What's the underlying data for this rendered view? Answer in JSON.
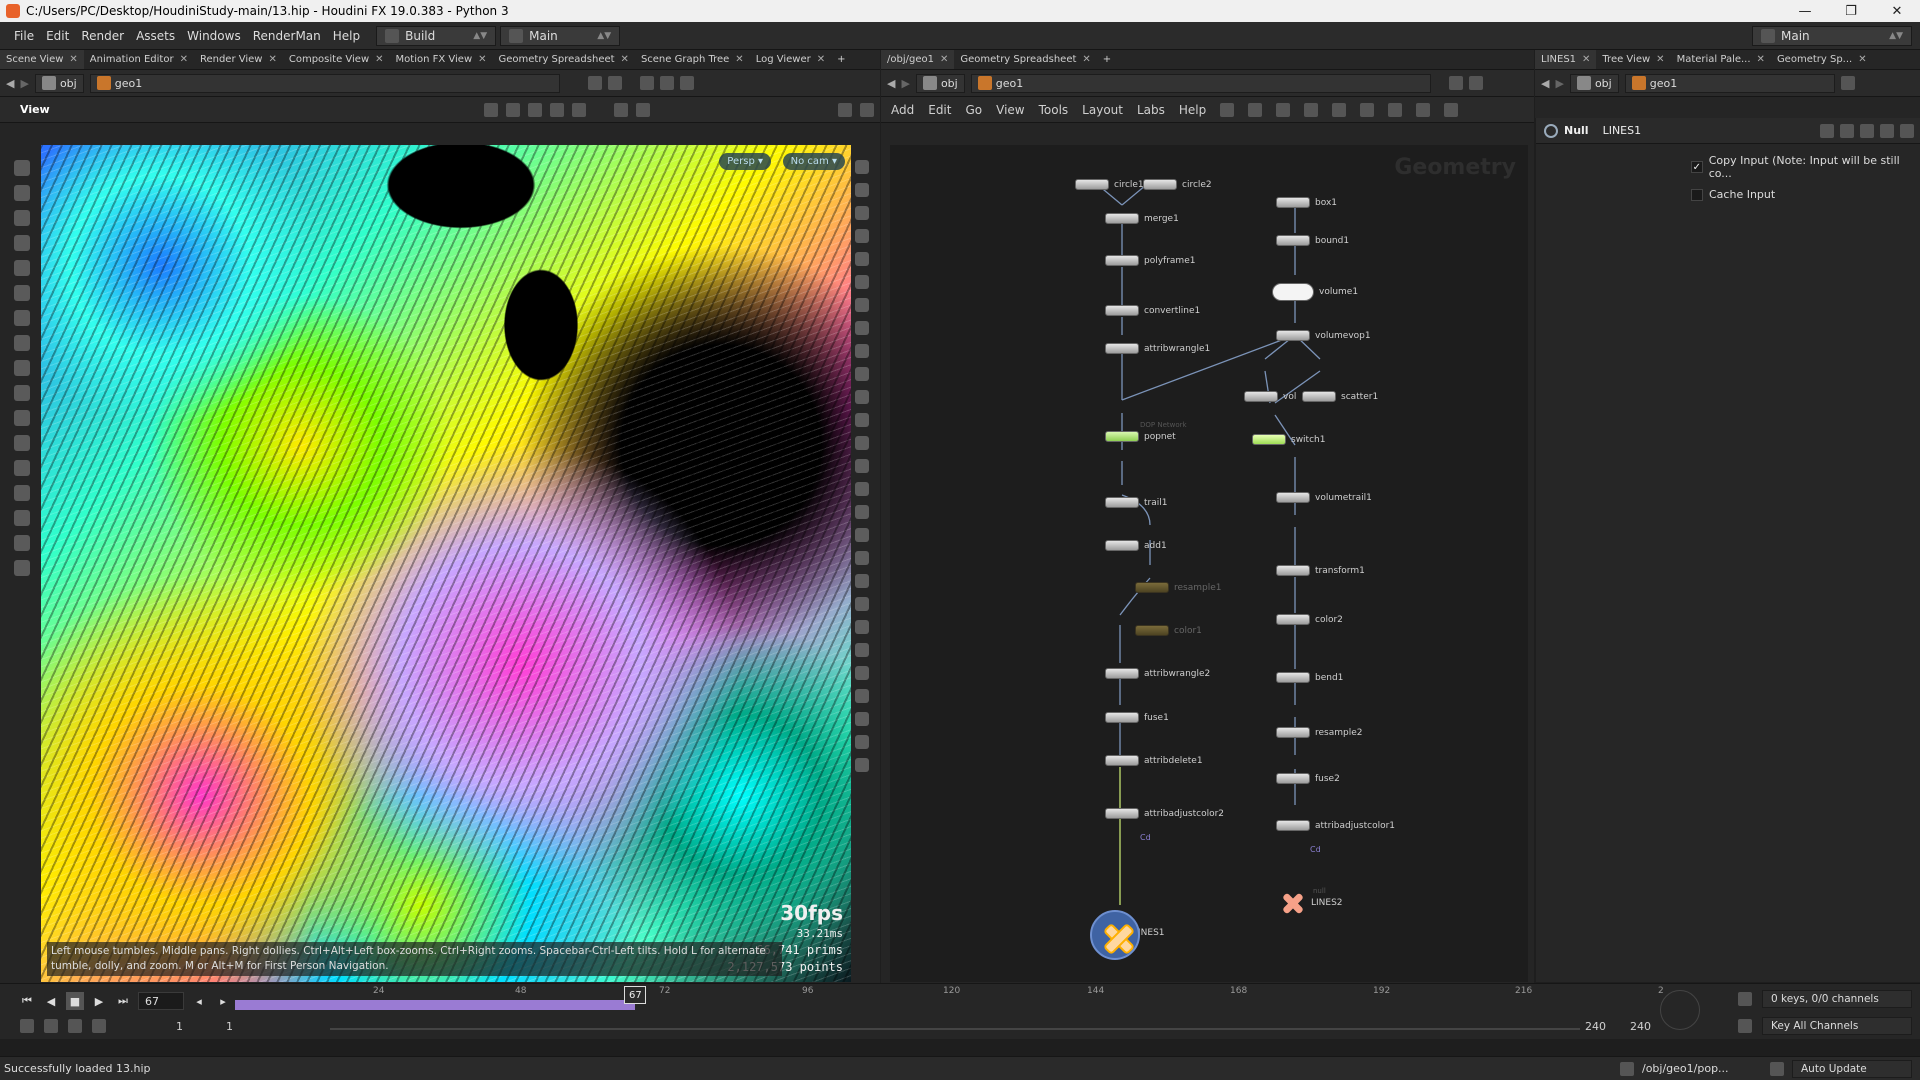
{
  "window": {
    "title": "C:/Users/PC/Desktop/HoudiniStudy-main/13.hip - Houdini FX 19.0.383 - Python 3"
  },
  "menu": {
    "items": [
      "File",
      "Edit",
      "Render",
      "Assets",
      "Windows",
      "RenderMan",
      "Help"
    ],
    "desktop_left": "Build",
    "desktop_right": "Main",
    "desktop_far_right": "Main"
  },
  "left_tabs": [
    "Scene View",
    "Animation Editor",
    "Render View",
    "Composite View",
    "Motion FX View",
    "Geometry Spreadsheet",
    "Scene Graph Tree",
    "Log Viewer"
  ],
  "mid_tabs": [
    "/obj/geo1",
    "Geometry Spreadsheet"
  ],
  "right_tabs": [
    "LINES1",
    "Tree View",
    "Material Pale...",
    "Geometry Sp..."
  ],
  "path": {
    "obj": "obj",
    "geo": "geo1"
  },
  "viewer": {
    "title": "View",
    "persp": "Persp",
    "cam": "No cam",
    "fps": "30fps",
    "ms": "33.21ms",
    "prims": "66,741  prims",
    "points": "2,127,573 points",
    "hint": "Left mouse tumbles. Middle pans. Right dollies. Ctrl+Alt+Left box-zooms. Ctrl+Right zooms. Spacebar-Ctrl-Left tilts. Hold L for alternate tumble, dolly, and zoom. M or Alt+M for First Person Navigation."
  },
  "network": {
    "menu": [
      "Add",
      "Edit",
      "Go",
      "View",
      "Tools",
      "Layout",
      "Labs",
      "Help"
    ],
    "watermark": "Geometry",
    "dop_label": "DOP Network",
    "cd_label": "Cd",
    "nodes_left": {
      "circle1": "circle1",
      "circle2": "circle2",
      "merge1": "merge1",
      "polyframe1": "polyframe1",
      "convertline1": "convertline1",
      "attribwrangle1": "attribwrangle1",
      "popnet": "popnet",
      "trail1": "trail1",
      "add1": "add1",
      "resample1": "resample1",
      "color1": "color1",
      "attribwrangle2": "attribwrangle2",
      "fuse1": "fuse1",
      "attribdelete1": "attribdelete1",
      "attribadjustcolor2": "attribadjustcolor2",
      "lines1": "LINES1"
    },
    "nodes_right": {
      "box1": "box1",
      "bound1": "bound1",
      "volume1": "volume1",
      "volumevop1": "volumevop1",
      "vol": "vol",
      "scatter1": "scatter1",
      "switch1": "switch1",
      "volumetrail1": "volumetrail1",
      "transform1": "transform1",
      "color2": "color2",
      "bend1": "bend1",
      "resample2": "resample2",
      "fuse2": "fuse2",
      "attribadjustcolor1": "attribadjustcolor1",
      "null_label": "null",
      "lines2": "LINES2"
    }
  },
  "params": {
    "type": "Null",
    "name": "LINES1",
    "copy_input": "Copy Input (Note: Input will be still co...",
    "cache_input": "Cache Input"
  },
  "timeline": {
    "current_frame": "67",
    "ticks": [
      "24",
      "48",
      "72",
      "96",
      "120",
      "144",
      "168",
      "192",
      "216",
      "2"
    ],
    "start": "1",
    "start2": "1",
    "end": "240",
    "end2": "240",
    "played_fraction": 0.28,
    "keys": "0 keys, 0/0 channels",
    "key_all": "Key All Channels",
    "auto_update": "Auto Update"
  },
  "status": {
    "message": "Successfully loaded 13.hip",
    "path": "/obj/geo1/pop..."
  }
}
